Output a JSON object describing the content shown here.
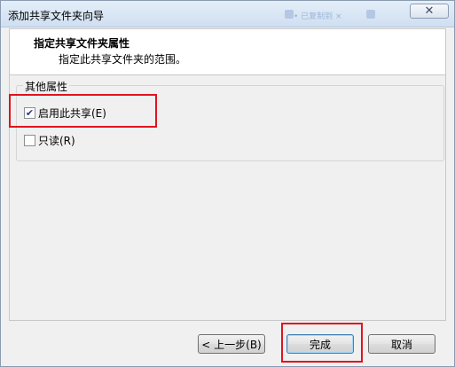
{
  "window": {
    "title": "添加共享文件夹向导",
    "blurred_title_text": "• 已复制到 ×",
    "close_glyph": "✕"
  },
  "header": {
    "title": "指定共享文件夹属性",
    "subtitle": "指定此共享文件夹的范围。"
  },
  "group": {
    "legend": "其他属性",
    "options": [
      {
        "label": "启用此共享(E)",
        "checked": true
      },
      {
        "label": "只读(R)",
        "checked": false
      }
    ]
  },
  "buttons": {
    "back": "< 上一步(B)",
    "finish": "完成",
    "cancel": "取消"
  },
  "colors": {
    "highlight": "#e0141f"
  }
}
